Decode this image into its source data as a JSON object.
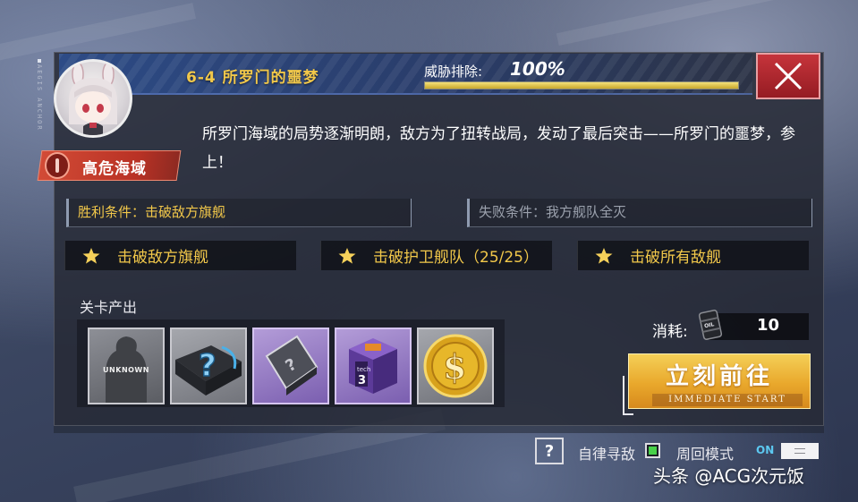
{
  "side_label": "AEGIS ANCHOR",
  "header": {
    "stage_title": "6-4 所罗门的噩梦",
    "threat_label": "威胁排除:",
    "threat_value": "100%",
    "threat_progress": 1.0
  },
  "close_icon": "close-icon",
  "avatar_icon": "chibi-character-avatar",
  "danger": {
    "label": "高危海域",
    "icon": "alert-icon"
  },
  "description": "所罗门海域的局势逐渐明朗，敌方为了扭转战局，发动了最后突击——所罗门的噩梦，参上！",
  "conditions": {
    "victory": "胜利条件：击破敌方旗舰",
    "defeat": "失败条件：我方舰队全灭"
  },
  "objectives": [
    {
      "label": "击破敌方旗舰",
      "icon": "star-icon"
    },
    {
      "label": "击破护卫舰队（25/25）",
      "icon": "star-icon"
    },
    {
      "label": "击破所有敌舰",
      "icon": "star-icon"
    }
  ],
  "rewards": {
    "title": "关卡产出",
    "items": [
      {
        "icon": "unknown-ship-icon",
        "text": "UNKNOWN"
      },
      {
        "icon": "mystery-box-icon"
      },
      {
        "icon": "mystery-blueprint-icon"
      },
      {
        "icon": "tech-box-icon",
        "text": "tech 3"
      },
      {
        "icon": "gold-coin-icon"
      }
    ]
  },
  "cost": {
    "label": "消耗:",
    "value": "10",
    "icon": "oil-barrel-icon"
  },
  "start_button": {
    "label": "立刻前往",
    "sub_label": "IMMEDIATE START"
  },
  "footer": {
    "help_icon": "help-icon",
    "auto_label": "自律寻敌",
    "cycle_label": "周回模式",
    "cycle_state": "ON"
  },
  "watermark": "头条 @ACG次元饭",
  "colors": {
    "title_gold": "#f2c84a",
    "danger_red": "#c53a2a",
    "close_red": "#b02a31",
    "start_orange": "#e9a82c",
    "check_green": "#48d14a",
    "on_blue": "#5cc8f0"
  }
}
